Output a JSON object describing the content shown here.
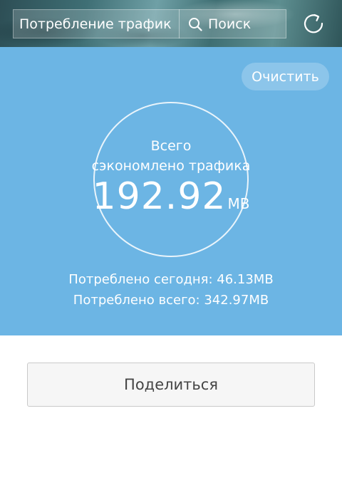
{
  "header": {
    "title": "Потребление трафик",
    "search_label": "Поиск",
    "icons": {
      "search": "search-icon",
      "refresh": "refresh-icon"
    }
  },
  "panel": {
    "clear_label": "Очистить",
    "saved_caption_line1": "Всего",
    "saved_caption_line2": "сэкономлено трафика",
    "saved_value": "192.92",
    "saved_unit": "MB",
    "today": "Потреблено сегодня: 46.13MB",
    "total": "Потреблено всего: 342.97MB"
  },
  "actions": {
    "share_label": "Поделиться"
  },
  "colors": {
    "panel_bg": "#6cb5e4",
    "text_on_panel": "#ffffff"
  }
}
